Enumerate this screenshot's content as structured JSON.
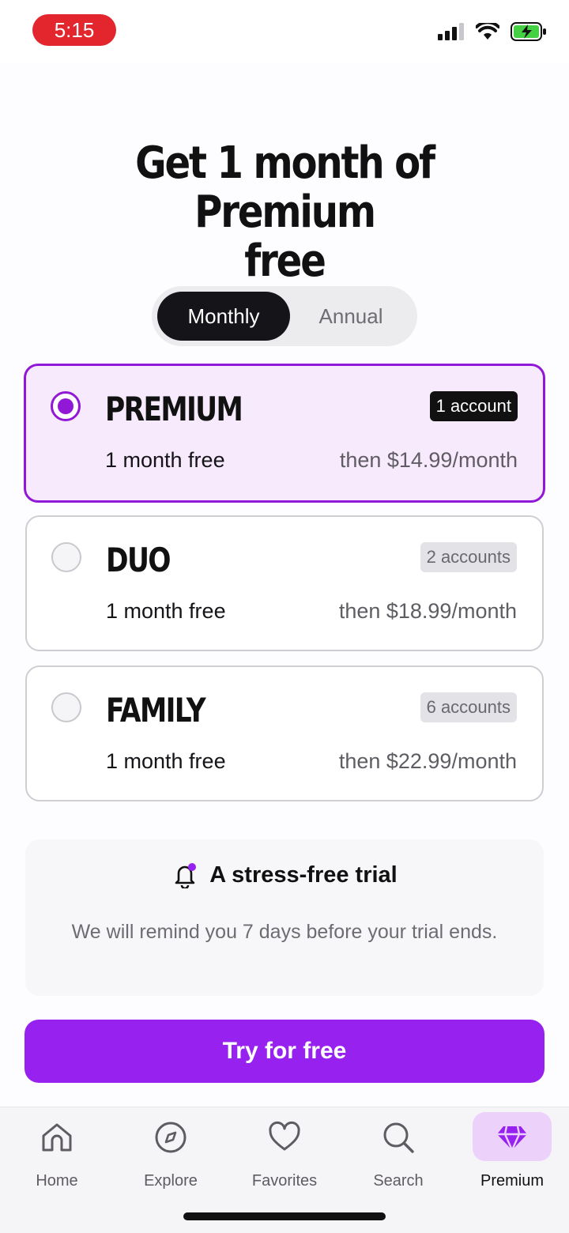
{
  "status_bar": {
    "time": "5:15"
  },
  "headline": {
    "line1": "Get 1 month of Premium",
    "line2": "free"
  },
  "billing_toggle": {
    "monthly": "Monthly",
    "annual": "Annual",
    "selected": "Monthly"
  },
  "plans": [
    {
      "name": "PREMIUM",
      "badge": "1 account",
      "free_text": "1 month free",
      "price": "then $14.99/month",
      "selected": true
    },
    {
      "name": "DUO",
      "badge": "2 accounts",
      "free_text": "1 month free",
      "price": "then $18.99/month",
      "selected": false
    },
    {
      "name": "FAMILY",
      "badge": "6 accounts",
      "free_text": "1 month free",
      "price": "then $22.99/month",
      "selected": false
    }
  ],
  "trial": {
    "icon": "bell-icon",
    "title": "A stress-free trial",
    "body": "We will remind you 7 days before your trial ends."
  },
  "cta": {
    "label": "Try for free"
  },
  "tabs": [
    {
      "label": "Home",
      "icon": "home-icon"
    },
    {
      "label": "Explore",
      "icon": "compass-icon"
    },
    {
      "label": "Favorites",
      "icon": "heart-icon"
    },
    {
      "label": "Search",
      "icon": "search-icon"
    },
    {
      "label": "Premium",
      "icon": "diamond-icon",
      "active": true
    }
  ],
  "colors": {
    "accent": "#9722f0",
    "selected_border": "#9118d6",
    "selected_bg": "#f7eafc",
    "time_pill": "#e3262d"
  }
}
